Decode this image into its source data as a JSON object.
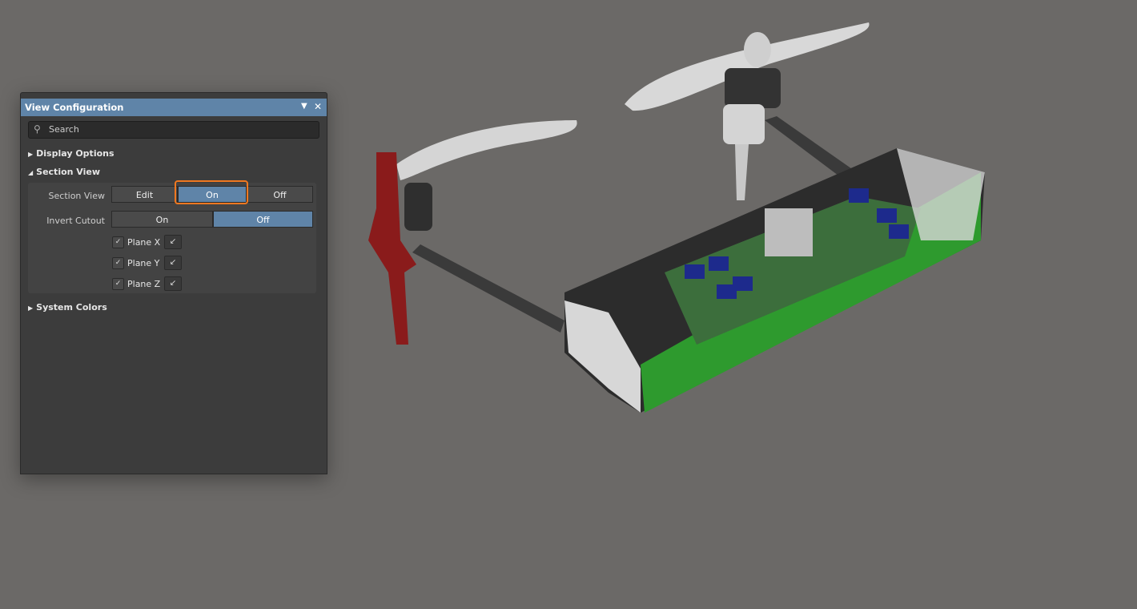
{
  "panel": {
    "title": "View Configuration",
    "search_placeholder": "Search",
    "sections": {
      "display_options": "Display Options",
      "section_view": "Section View",
      "system_colors": "System Colors"
    },
    "section_view_row": {
      "label": "Section View",
      "options": [
        "Edit",
        "On",
        "Off"
      ],
      "selected": "On"
    },
    "invert_cutout_row": {
      "label": "Invert Cutout",
      "options": [
        "On",
        "Off"
      ],
      "selected": "Off"
    },
    "planes": [
      {
        "label": "Plane X",
        "checked": true
      },
      {
        "label": "Plane Y",
        "checked": true
      },
      {
        "label": "Plane Z",
        "checked": true
      }
    ]
  },
  "colors": {
    "accent": "#5f84a8",
    "highlight": "#f07820",
    "background": "#6b6967"
  }
}
